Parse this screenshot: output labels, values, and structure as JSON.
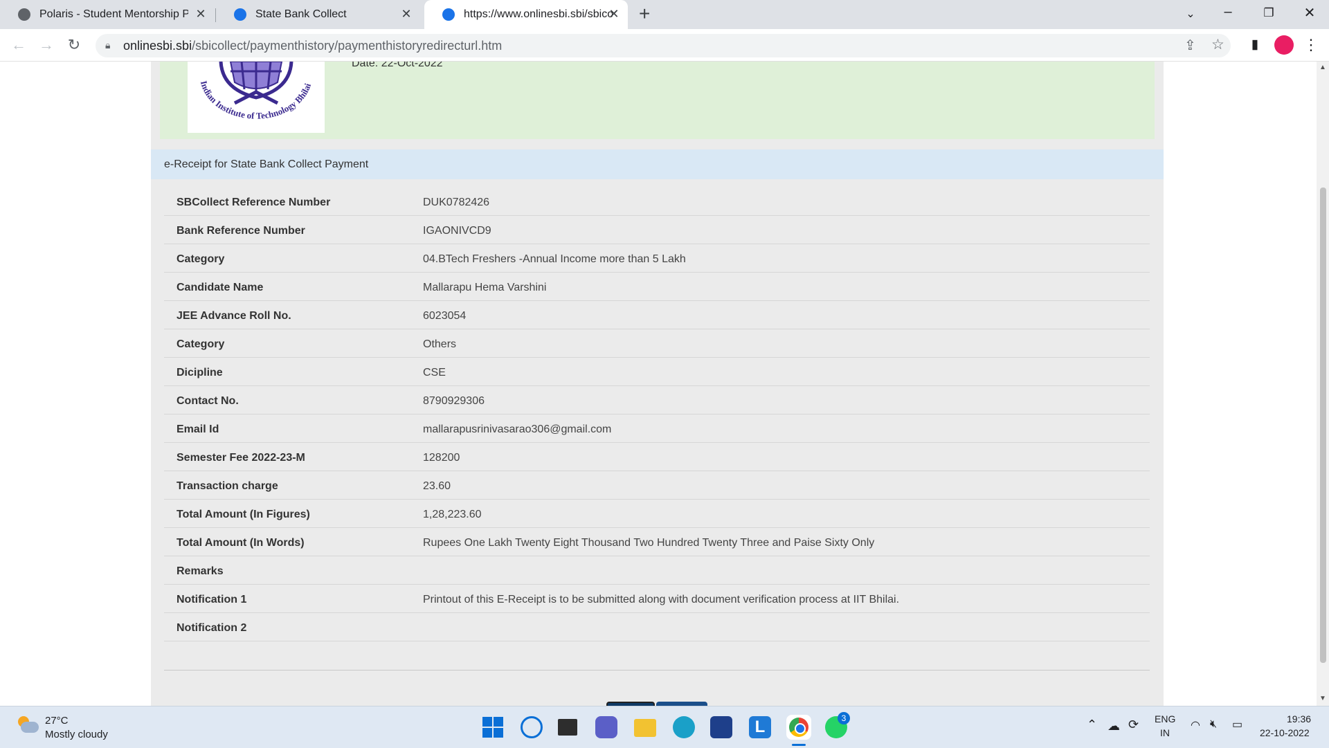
{
  "browser": {
    "tabs": [
      {
        "title": "Polaris - Student Mentorship Pro",
        "close": "✕"
      },
      {
        "title": "State Bank Collect",
        "close": "✕"
      },
      {
        "title": "https://www.onlinesbi.sbi/sbicolle",
        "close": "✕"
      }
    ],
    "new_tab": "+",
    "url_host": "onlinesbi.sbi",
    "url_path": "/sbicollect/paymenthistory/paymenthistoryredirecturl.htm"
  },
  "header": {
    "date": "Date: 22-Oct-2022",
    "logo_text": "Indian Institute of Technology Bhilai"
  },
  "receipt": {
    "heading": "e-Receipt for State Bank Collect Payment",
    "rows": [
      {
        "label": "SBCollect Reference Number",
        "value": "DUK0782426"
      },
      {
        "label": "Bank Reference Number",
        "value": "IGAONIVCD9"
      },
      {
        "label": "Category",
        "value": "04.BTech Freshers -Annual Income more than 5 Lakh"
      },
      {
        "label": "Candidate Name",
        "value": "Mallarapu Hema Varshini"
      },
      {
        "label": "JEE Advance Roll No.",
        "value": "6023054"
      },
      {
        "label": "Category",
        "value": "Others"
      },
      {
        "label": "Dicipline",
        "value": "CSE"
      },
      {
        "label": "Contact No.",
        "value": "8790929306"
      },
      {
        "label": "Email Id",
        "value": "mallarapusrinivasarao306@gmail.com"
      },
      {
        "label": "Semester Fee 2022-23-M",
        "value": "128200"
      },
      {
        "label": "Transaction charge",
        "value": "23.60"
      },
      {
        "label": "Total Amount (In Figures)",
        "value": "1,28,223.60"
      },
      {
        "label": "Total Amount (In Words)",
        "value": "Rupees One Lakh Twenty Eight Thousand Two Hundred Twenty Three and Paise Sixty Only"
      },
      {
        "label": "Remarks",
        "value": ""
      },
      {
        "label": "Notification 1",
        "value": "Printout of this E-Receipt is to be submitted along with document verification process at IIT Bhilai."
      },
      {
        "label": "Notification 2",
        "value": ""
      }
    ]
  },
  "taskbar": {
    "weather_temp": "27°C",
    "weather_desc": "Mostly cloudy",
    "lang_top": "ENG",
    "lang_bottom": "IN",
    "time": "19:36",
    "date": "22-10-2022",
    "whatsapp_badge": "3"
  }
}
